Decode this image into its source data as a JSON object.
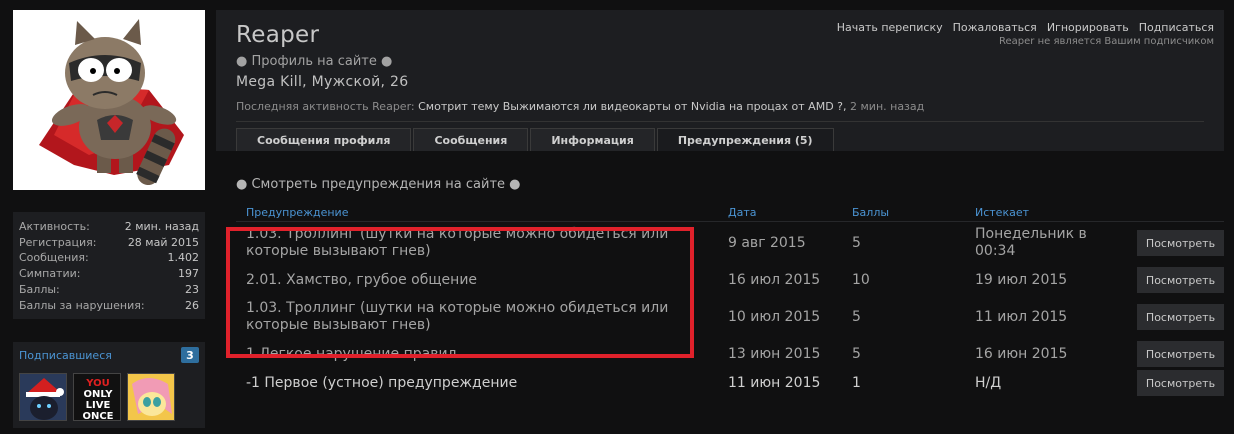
{
  "profile": {
    "username": "Reaper",
    "profile_link": "● Профиль на сайте ●",
    "meta": "Mega Kill, Мужской, 26",
    "activity_prefix": "Последняя активность Reaper:",
    "activity_link": "Смотрит тему Выжимаются ли видеокарты от Nvidia на процах от AMD ?,",
    "activity_time": "2 мин. назад"
  },
  "actions": {
    "start_conversation": "Начать переписку",
    "report": "Пожаловаться",
    "ignore": "Игнорировать",
    "follow": "Подписаться",
    "note": "Reaper не является Вашим подписчиком"
  },
  "tabs": [
    {
      "label": "Сообщения профиля",
      "active": false
    },
    {
      "label": "Сообщения",
      "active": false
    },
    {
      "label": "Информация",
      "active": false
    },
    {
      "label": "Предупреждения (5)",
      "active": true
    }
  ],
  "stats": [
    {
      "label": "Активность:",
      "value": "2 мин. назад"
    },
    {
      "label": "Регистрация:",
      "value": "28 май 2015"
    },
    {
      "label": "Сообщения:",
      "value": "1.402"
    },
    {
      "label": "Симпатии:",
      "value": "197"
    },
    {
      "label": "Баллы:",
      "value": "23"
    },
    {
      "label": "Баллы за нарушения:",
      "value": "26"
    }
  ],
  "followers": {
    "title": "Подписавшиеся",
    "count": "3",
    "avatar_texts": [
      "YOU",
      "ONLY",
      "LIVE",
      "ONCE"
    ]
  },
  "warnings": {
    "section_title": "● Смотреть предупреждения на сайте ●",
    "headers": {
      "warning": "Предупреждение",
      "date": "Дата",
      "points": "Баллы",
      "expires": "Истекает"
    },
    "view_label": "Посмотреть",
    "rows": [
      {
        "warning": "1.03. Троллинг (шутки на которые можно обидеться или которые вызывают гнев)",
        "date": "9 авг 2015",
        "points": "5",
        "expires": "Понедельник в 00:34"
      },
      {
        "warning": "2.01. Хамство, грубое общение",
        "date": "16 июл 2015",
        "points": "10",
        "expires": "19 июл 2015"
      },
      {
        "warning": "1.03. Троллинг (шутки на которые можно обидеться или которые вызывают гнев)",
        "date": "10 июл 2015",
        "points": "5",
        "expires": "11 июл 2015"
      },
      {
        "warning": "1 Легкое нарушение правил",
        "date": "13 июн 2015",
        "points": "5",
        "expires": "16 июн 2015"
      },
      {
        "warning": "-1 Первое (устное) предупреждение",
        "date": "11 июн 2015",
        "points": "1",
        "expires": "Н/Д"
      }
    ]
  },
  "colors": {
    "background": "#101011",
    "panel": "#1d1e21",
    "link_blue": "#4b94d3",
    "highlight_red": "#e0212b"
  }
}
